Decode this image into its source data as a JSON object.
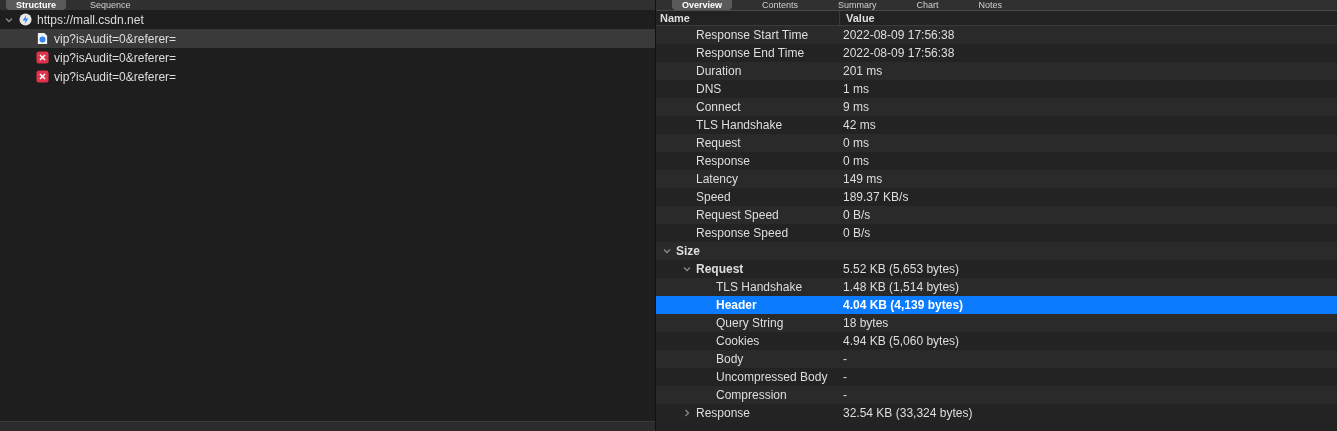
{
  "left_tabs": [
    {
      "label": "Structure",
      "selected": true
    },
    {
      "label": "Sequence",
      "selected": false
    }
  ],
  "right_tabs": [
    {
      "label": "Overview",
      "selected": true
    },
    {
      "label": "Contents",
      "selected": false
    },
    {
      "label": "Summary",
      "selected": false
    },
    {
      "label": "Chart",
      "selected": false
    },
    {
      "label": "Notes",
      "selected": false
    }
  ],
  "structure": [
    {
      "label": "https://mall.csdn.net",
      "kind": "host",
      "expanded": true,
      "selected": false,
      "children": [
        {
          "label": "vip?isAudit=0&referer=",
          "kind": "pending",
          "selected": true
        },
        {
          "label": "vip?isAudit=0&referer=",
          "kind": "failed",
          "selected": false
        },
        {
          "label": "vip?isAudit=0&referer=",
          "kind": "failed",
          "selected": false
        }
      ]
    }
  ],
  "table": {
    "columns": [
      "Name",
      "Value"
    ],
    "rows": [
      {
        "name": "Response Start Time",
        "value": "2022-08-09 17:56:38"
      },
      {
        "name": "Response End Time",
        "value": "2022-08-09 17:56:38"
      },
      {
        "name": "Duration",
        "value": "201 ms"
      },
      {
        "name": "DNS",
        "value": "1 ms"
      },
      {
        "name": "Connect",
        "value": "9 ms"
      },
      {
        "name": "TLS Handshake",
        "value": "42 ms"
      },
      {
        "name": "Request",
        "value": "0 ms"
      },
      {
        "name": "Response",
        "value": "0 ms"
      },
      {
        "name": "Latency",
        "value": "149 ms"
      },
      {
        "name": "Speed",
        "value": "189.37 KB/s"
      },
      {
        "name": "Request Speed",
        "value": "0 B/s"
      },
      {
        "name": "Response Speed",
        "value": "0 B/s"
      }
    ],
    "groups": [
      {
        "name": "Size",
        "expanded": true,
        "children": [
          {
            "name": "Request",
            "value": "5.52 KB (5,653 bytes)",
            "expanded": true,
            "children": [
              {
                "name": "TLS Handshake",
                "value": "1.48 KB (1,514 bytes)",
                "selected": false
              },
              {
                "name": "Header",
                "value": "4.04 KB (4,139 bytes)",
                "selected": true
              },
              {
                "name": "Query String",
                "value": "18 bytes",
                "selected": false
              },
              {
                "name": "Cookies",
                "value": "4.94 KB (5,060 bytes)",
                "selected": false
              },
              {
                "name": "Body",
                "value": "-",
                "selected": false
              },
              {
                "name": "Uncompressed Body",
                "value": "-",
                "selected": false
              },
              {
                "name": "Compression",
                "value": "-",
                "selected": false
              }
            ]
          },
          {
            "name": "Response",
            "value": "32.54 KB (33,324 bytes)",
            "expanded": false
          }
        ]
      }
    ]
  }
}
